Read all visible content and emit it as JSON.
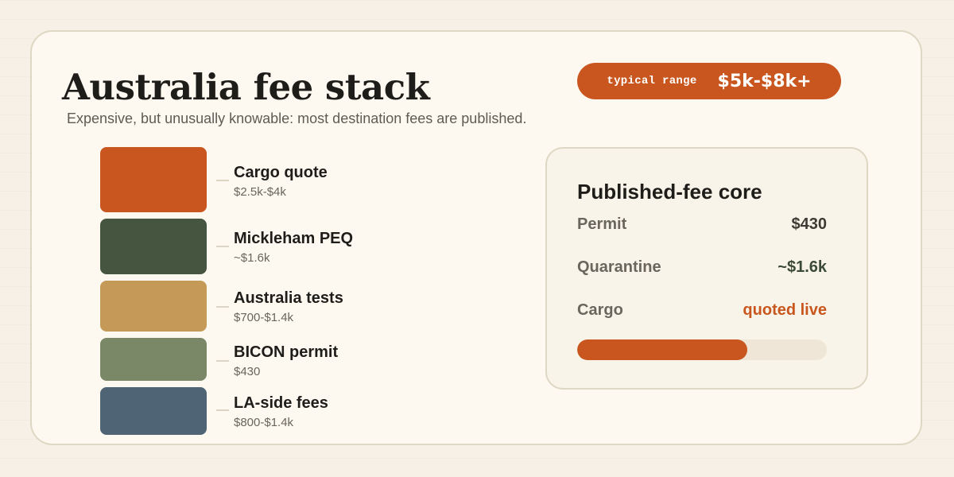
{
  "header": {
    "title": "Australia fee stack",
    "subtitle": "Expensive, but unusually knowable: most destination fees are published."
  },
  "range": {
    "label": "typical range",
    "value": "$5k-$8k+"
  },
  "stack": {
    "items": [
      {
        "name": "Cargo quote",
        "range": "$2.5k-$4k",
        "color": "#c8561e"
      },
      {
        "name": "Mickleham PEQ",
        "range": "~$1.6k",
        "color": "#465540"
      },
      {
        "name": "Australia tests",
        "range": "$700-$1.4k",
        "color": "#c59a58"
      },
      {
        "name": "BICON permit",
        "range": "$430",
        "color": "#7a8868"
      },
      {
        "name": "LA-side fees",
        "range": "$800-$1.4k",
        "color": "#4f6575"
      }
    ]
  },
  "core": {
    "title": "Published-fee core",
    "rows": [
      {
        "label": "Permit",
        "value": "$430",
        "value_color": "#3d3a34"
      },
      {
        "label": "Quarantine",
        "value": "~$1.6k",
        "value_color": "#3b4a37"
      },
      {
        "label": "Cargo",
        "value": "quoted live",
        "value_color": "#c8561e"
      }
    ],
    "progress_fraction": 0.68,
    "progress_color": "#c8561e"
  }
}
